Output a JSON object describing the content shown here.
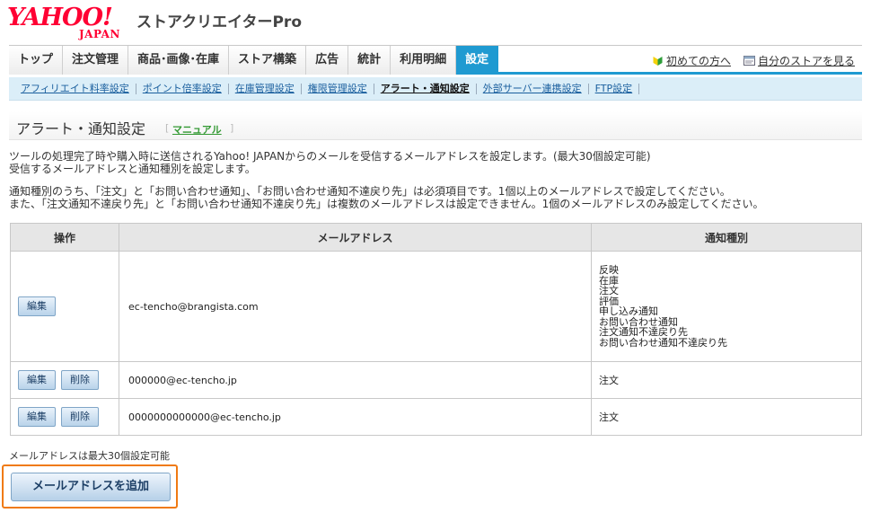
{
  "header": {
    "logo_text": "YAHOO!",
    "logo_sub": "JAPAN",
    "app_title": "ストアクリエイターPro"
  },
  "nav": {
    "tabs": [
      {
        "label": "トップ"
      },
      {
        "label": "注文管理"
      },
      {
        "label": "商品･画像･在庫"
      },
      {
        "label": "ストア構築"
      },
      {
        "label": "広告"
      },
      {
        "label": "統計"
      },
      {
        "label": "利用明細"
      },
      {
        "label": "設定",
        "active": true
      }
    ],
    "links": [
      {
        "label": "初めての方へ",
        "icon": "beginner-leaf-icon"
      },
      {
        "label": "自分のストアを見る",
        "icon": "store-window-icon"
      }
    ]
  },
  "subnav": {
    "items": [
      {
        "label": "アフィリエイト料率設定"
      },
      {
        "label": "ポイント倍率設定"
      },
      {
        "label": "在庫管理設定"
      },
      {
        "label": "権限管理設定"
      },
      {
        "label": "アラート・通知設定",
        "active": true
      },
      {
        "label": "外部サーバー連携設定"
      },
      {
        "label": "FTP設定"
      }
    ]
  },
  "page": {
    "title": "アラート・通知設定",
    "manual_link": "マニュアル"
  },
  "description": {
    "line1": "ツールの処理完了時や購入時に送信されるYahoo! JAPANからのメールを受信するメールアドレスを設定します。(最大30個設定可能)",
    "line2": "受信するメールアドレスと通知種別を設定します。",
    "line3": "通知種別のうち、「注文」と「お問い合わせ通知」、「お問い合わせ通知不達戻り先」は必須項目です。1個以上のメールアドレスで設定してください。",
    "line4": "また、「注文通知不達戻り先」と「お問い合わせ通知不達戻り先」は複数のメールアドレスは設定できません。1個のメールアドレスのみ設定してください。"
  },
  "table": {
    "headers": {
      "operation": "操作",
      "email": "メールアドレス",
      "type": "通知種別"
    },
    "edit_label": "編集",
    "delete_label": "削除",
    "rows": [
      {
        "email": "ec-tencho@brangista.com",
        "types": [
          "反映",
          "在庫",
          "注文",
          "評価",
          "申し込み通知",
          "お問い合わせ通知",
          "注文通知不達戻り先",
          "お問い合わせ通知不達戻り先"
        ],
        "deletable": false
      },
      {
        "email": "000000@ec-tencho.jp",
        "types": [
          "注文"
        ],
        "deletable": true
      },
      {
        "email": "0000000000000@ec-tencho.jp",
        "types": [
          "注文"
        ],
        "deletable": true
      }
    ]
  },
  "footer": {
    "note": "メールアドレスは最大30個設定可能",
    "add_button": "メールアドレスを追加"
  },
  "colors": {
    "brand": "#ff0033",
    "nav_active": "#1f9ad1",
    "subnav_bg": "#dbeef8",
    "highlight": "#f07a12"
  }
}
